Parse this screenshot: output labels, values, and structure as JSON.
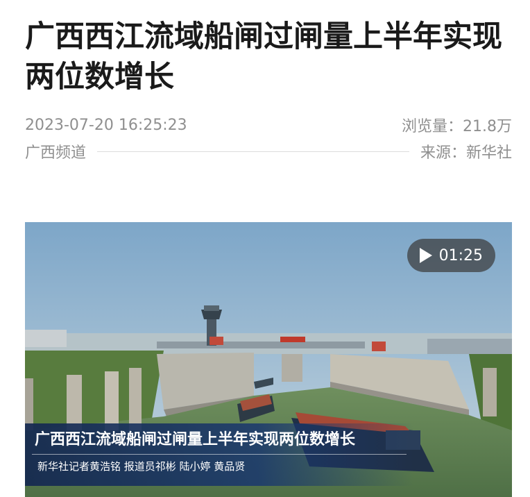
{
  "article": {
    "title": "广西西江流域船闸过闸量上半年实现两位数增长",
    "datetime": "2023-07-20 16:25:23",
    "views": "浏览量：21.8万",
    "channel": "广西频道",
    "source": "来源：新华社"
  },
  "video": {
    "duration": "01:25",
    "caption_title": "广西西江流域船闸过闸量上半年实现两位数增长",
    "caption_credits": "新华社记者黄浩铭 报道员祁彬 陆小婷 黄品贤"
  },
  "colors": {
    "title": "#1a1a1a",
    "meta": "#8f8f8f",
    "caption_bg": "#1c3a6e"
  },
  "icons": {
    "play": "play-icon"
  }
}
